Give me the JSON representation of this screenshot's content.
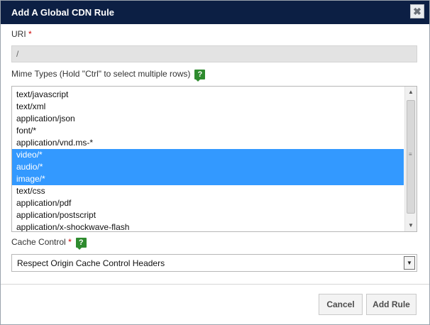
{
  "dialog": {
    "title": "Add A Global CDN Rule",
    "close_symbol": "✖"
  },
  "uri": {
    "label": "URI",
    "required_mark": "*",
    "value": "/"
  },
  "mime_types": {
    "label": "Mime Types (Hold \"Ctrl\" to select multiple rows)",
    "help_symbol": "?",
    "options": [
      {
        "label": "text/javascript",
        "selected": false
      },
      {
        "label": "text/xml",
        "selected": false
      },
      {
        "label": "application/json",
        "selected": false
      },
      {
        "label": "font/*",
        "selected": false
      },
      {
        "label": "application/vnd.ms-*",
        "selected": false
      },
      {
        "label": "video/*",
        "selected": true
      },
      {
        "label": "audio/*",
        "selected": true
      },
      {
        "label": "image/*",
        "selected": true
      },
      {
        "label": "text/css",
        "selected": false
      },
      {
        "label": "application/pdf",
        "selected": false
      },
      {
        "label": "application/postscript",
        "selected": false
      },
      {
        "label": "application/x-shockwave-flash",
        "selected": false
      }
    ]
  },
  "cache_control": {
    "label": "Cache Control",
    "required_mark": "*",
    "help_symbol": "?",
    "selected_value": "Respect Origin Cache Control Headers"
  },
  "buttons": {
    "cancel": "Cancel",
    "add_rule": "Add Rule"
  },
  "colors": {
    "titlebar": "#0c1f44",
    "selection": "#3399ff",
    "help_icon": "#2e8b2e",
    "required": "#cc0000"
  }
}
